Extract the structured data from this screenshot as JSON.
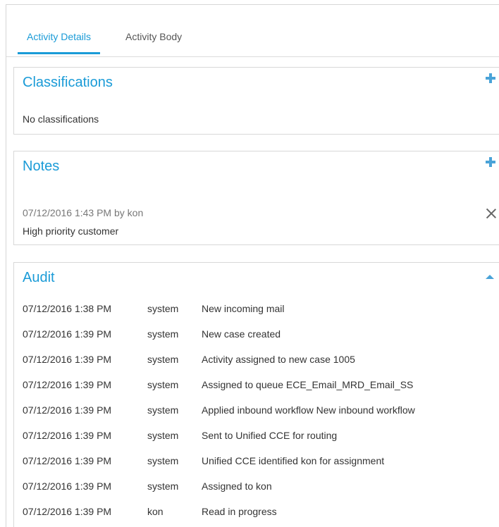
{
  "tabs": [
    {
      "label": "Activity Details",
      "active": true
    },
    {
      "label": "Activity Body",
      "active": false
    }
  ],
  "classifications": {
    "title": "Classifications",
    "empty_text": "No classifications",
    "add_icon": "plus-icon"
  },
  "notes": {
    "title": "Notes",
    "add_icon": "plus-icon",
    "items": [
      {
        "meta": "07/12/2016 1:43 PM by kon",
        "text": "High priority customer",
        "delete_icon": "close-icon"
      }
    ]
  },
  "audit": {
    "title": "Audit",
    "collapse_icon": "chevron-up-icon",
    "rows": [
      {
        "time": "07/12/2016 1:38 PM",
        "user": "system",
        "event": "New incoming mail"
      },
      {
        "time": "07/12/2016 1:39 PM",
        "user": "system",
        "event": "New case created"
      },
      {
        "time": "07/12/2016 1:39 PM",
        "user": "system",
        "event": "Activity assigned to new case 1005"
      },
      {
        "time": "07/12/2016 1:39 PM",
        "user": "system",
        "event": "Assigned to queue ECE_Email_MRD_Email_SS"
      },
      {
        "time": "07/12/2016 1:39 PM",
        "user": "system",
        "event": "Applied inbound workflow New inbound workflow"
      },
      {
        "time": "07/12/2016 1:39 PM",
        "user": "system",
        "event": "Sent to Unified CCE for routing"
      },
      {
        "time": "07/12/2016 1:39 PM",
        "user": "system",
        "event": "Unified CCE identified kon for assignment"
      },
      {
        "time": "07/12/2016 1:39 PM",
        "user": "system",
        "event": "Assigned to kon"
      },
      {
        "time": "07/12/2016 1:39 PM",
        "user": "kon",
        "event": "Read in progress"
      }
    ]
  },
  "colors": {
    "accent": "#1a9bd7",
    "border": "#d8d8d8",
    "text": "#333333",
    "muted": "#777777"
  }
}
